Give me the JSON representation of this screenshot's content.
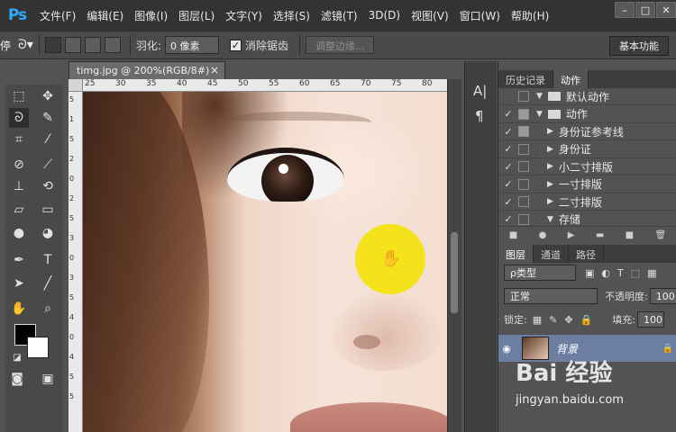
{
  "app": {
    "logo": "Ps"
  },
  "menubar": {
    "items": [
      "文件(F)",
      "编辑(E)",
      "图像(I)",
      "图层(L)",
      "文字(Y)",
      "选择(S)",
      "滤镜(T)",
      "3D(D)",
      "视图(V)",
      "窗口(W)",
      "帮助(H)"
    ]
  },
  "window_controls": {
    "minimize": "–",
    "maximize": "□",
    "close": "✕"
  },
  "options": {
    "left_cut_text": "停",
    "feather_label": "羽化:",
    "feather_value": "0 像素",
    "antialias_label": "消除锯齿",
    "antialias_checked": "✓",
    "refine_edge_label": "调整边缘...",
    "workspace_label": "基本功能"
  },
  "document": {
    "tab_title": "timg.jpg @ 200%(RGB/8#)",
    "close": "×"
  },
  "ruler": {
    "h_ticks": [
      "25",
      "30",
      "35",
      "40",
      "45",
      "50",
      "55",
      "60",
      "65",
      "70",
      "75",
      "80"
    ],
    "v_ticks": [
      "5",
      "1",
      "5",
      "2",
      "0",
      "2",
      "5",
      "3",
      "0",
      "3",
      "5",
      "4",
      "0",
      "4",
      "5",
      "5"
    ]
  },
  "panels": {
    "top_tabs": [
      "历史记录",
      "动作"
    ],
    "actions": [
      {
        "check": "",
        "box": "empty",
        "expand": "▼",
        "folder": true,
        "label": "默认动作"
      },
      {
        "check": "✓",
        "box": "filled",
        "expand": "▼",
        "folder": true,
        "label": "动作"
      },
      {
        "check": "✓",
        "box": "filled",
        "expand": "▶",
        "folder": false,
        "label": "身份证参考线"
      },
      {
        "check": "✓",
        "box": "empty",
        "expand": "▶",
        "folder": false,
        "label": "身份证"
      },
      {
        "check": "✓",
        "box": "empty",
        "expand": "▶",
        "folder": false,
        "label": "小二寸排版"
      },
      {
        "check": "✓",
        "box": "empty",
        "expand": "▶",
        "folder": false,
        "label": "一寸排版"
      },
      {
        "check": "✓",
        "box": "empty",
        "expand": "▶",
        "folder": false,
        "label": "二寸排版"
      },
      {
        "check": "✓",
        "box": "empty",
        "expand": "▼",
        "folder": false,
        "label": "存储"
      }
    ],
    "action_buttons": [
      "■",
      "●",
      "▶",
      "▬",
      "■",
      "🗑"
    ],
    "layer_tabs": [
      "图层",
      "通道",
      "路径"
    ],
    "filter_label": "ρ类型",
    "blend_mode": "正常",
    "opacity_label": "不透明度:",
    "opacity_value": "100",
    "lock_label": "锁定:",
    "fill_label": "填充:",
    "fill_value": "100",
    "layer_name": "背景"
  },
  "watermark": {
    "brand": "Bai 经验",
    "url": "jingyan.baidu.com"
  }
}
